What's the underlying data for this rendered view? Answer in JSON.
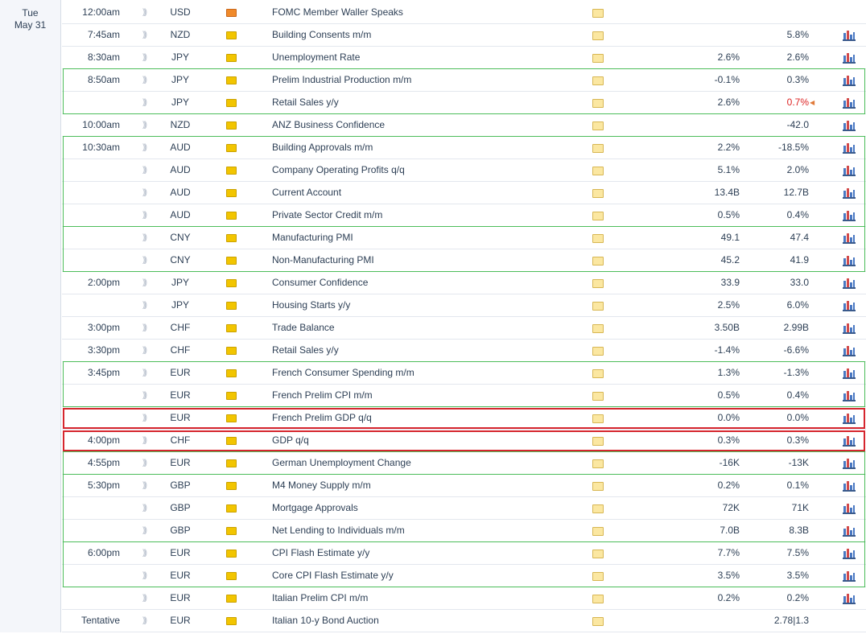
{
  "day": {
    "weekday": "Tue",
    "date": "May 31"
  },
  "colors": {
    "group_border": "#4cbd5a",
    "highlight_border": "#d6262e",
    "revised_value": "#dd2222"
  },
  "icons": {
    "sound": "sound-wave-icon",
    "volatility": "volatility-flag-icon",
    "detail": "folder-icon",
    "chart": "bar-chart-icon"
  },
  "rows": [
    {
      "time": "12:00am",
      "currency": "USD",
      "impact": "high",
      "event": "FOMC Member Waller Speaks",
      "forecast": "",
      "previous": "",
      "chart": false
    },
    {
      "time": "7:45am",
      "currency": "NZD",
      "impact": "medium",
      "event": "Building Consents m/m",
      "forecast": "",
      "previous": "5.8%",
      "chart": true
    },
    {
      "time": "8:30am",
      "currency": "JPY",
      "impact": "medium",
      "event": "Unemployment Rate",
      "forecast": "2.6%",
      "previous": "2.6%",
      "chart": true
    },
    {
      "time": "8:50am",
      "currency": "JPY",
      "impact": "medium",
      "event": "Prelim Industrial Production m/m",
      "forecast": "-0.1%",
      "previous": "0.3%",
      "chart": true
    },
    {
      "time": "",
      "currency": "JPY",
      "impact": "medium",
      "event": "Retail Sales y/y",
      "forecast": "2.6%",
      "previous": "0.7%",
      "revised": true,
      "chart": true
    },
    {
      "time": "10:00am",
      "currency": "NZD",
      "impact": "medium",
      "event": "ANZ Business Confidence",
      "forecast": "",
      "previous": "-42.0",
      "chart": true
    },
    {
      "time": "10:30am",
      "currency": "AUD",
      "impact": "medium",
      "event": "Building Approvals m/m",
      "forecast": "2.2%",
      "previous": "-18.5%",
      "chart": true
    },
    {
      "time": "",
      "currency": "AUD",
      "impact": "medium",
      "event": "Company Operating Profits q/q",
      "forecast": "5.1%",
      "previous": "2.0%",
      "chart": true
    },
    {
      "time": "",
      "currency": "AUD",
      "impact": "medium",
      "event": "Current Account",
      "forecast": "13.4B",
      "previous": "12.7B",
      "chart": true
    },
    {
      "time": "",
      "currency": "AUD",
      "impact": "medium",
      "event": "Private Sector Credit m/m",
      "forecast": "0.5%",
      "previous": "0.4%",
      "chart": true
    },
    {
      "time": "",
      "currency": "CNY",
      "impact": "medium",
      "event": "Manufacturing PMI",
      "forecast": "49.1",
      "previous": "47.4",
      "chart": true
    },
    {
      "time": "",
      "currency": "CNY",
      "impact": "medium",
      "event": "Non-Manufacturing PMI",
      "forecast": "45.2",
      "previous": "41.9",
      "chart": true
    },
    {
      "time": "2:00pm",
      "currency": "JPY",
      "impact": "medium",
      "event": "Consumer Confidence",
      "forecast": "33.9",
      "previous": "33.0",
      "chart": true
    },
    {
      "time": "",
      "currency": "JPY",
      "impact": "medium",
      "event": "Housing Starts y/y",
      "forecast": "2.5%",
      "previous": "6.0%",
      "chart": true
    },
    {
      "time": "3:00pm",
      "currency": "CHF",
      "impact": "medium",
      "event": "Trade Balance",
      "forecast": "3.50B",
      "previous": "2.99B",
      "chart": true
    },
    {
      "time": "3:30pm",
      "currency": "CHF",
      "impact": "medium",
      "event": "Retail Sales y/y",
      "forecast": "-1.4%",
      "previous": "-6.6%",
      "chart": true
    },
    {
      "time": "3:45pm",
      "currency": "EUR",
      "impact": "medium",
      "event": "French Consumer Spending m/m",
      "forecast": "1.3%",
      "previous": "-1.3%",
      "chart": true
    },
    {
      "time": "",
      "currency": "EUR",
      "impact": "medium",
      "event": "French Prelim CPI m/m",
      "forecast": "0.5%",
      "previous": "0.4%",
      "chart": true
    },
    {
      "time": "",
      "currency": "EUR",
      "impact": "medium",
      "event": "French Prelim GDP q/q",
      "forecast": "0.0%",
      "previous": "0.0%",
      "chart": true
    },
    {
      "time": "4:00pm",
      "currency": "CHF",
      "impact": "medium",
      "event": "GDP q/q",
      "forecast": "0.3%",
      "previous": "0.3%",
      "chart": true
    },
    {
      "time": "4:55pm",
      "currency": "EUR",
      "impact": "medium",
      "event": "German Unemployment Change",
      "forecast": "-16K",
      "previous": "-13K",
      "chart": true
    },
    {
      "time": "5:30pm",
      "currency": "GBP",
      "impact": "medium",
      "event": "M4 Money Supply m/m",
      "forecast": "0.2%",
      "previous": "0.1%",
      "chart": true
    },
    {
      "time": "",
      "currency": "GBP",
      "impact": "medium",
      "event": "Mortgage Approvals",
      "forecast": "72K",
      "previous": "71K",
      "chart": true
    },
    {
      "time": "",
      "currency": "GBP",
      "impact": "medium",
      "event": "Net Lending to Individuals m/m",
      "forecast": "7.0B",
      "previous": "8.3B",
      "chart": true
    },
    {
      "time": "6:00pm",
      "currency": "EUR",
      "impact": "medium",
      "event": "CPI Flash Estimate y/y",
      "forecast": "7.7%",
      "previous": "7.5%",
      "chart": true
    },
    {
      "time": "",
      "currency": "EUR",
      "impact": "medium",
      "event": "Core CPI Flash Estimate y/y",
      "forecast": "3.5%",
      "previous": "3.5%",
      "chart": true
    },
    {
      "time": "",
      "currency": "EUR",
      "impact": "medium",
      "event": "Italian Prelim CPI m/m",
      "forecast": "0.2%",
      "previous": "0.2%",
      "chart": true
    },
    {
      "time": "Tentative",
      "currency": "EUR",
      "impact": "medium",
      "event": "Italian 10-y Bond Auction",
      "forecast": "",
      "previous": "2.78|1.3",
      "chart": false
    }
  ],
  "groups": [
    {
      "start": 3,
      "count": 2
    },
    {
      "start": 6,
      "count": 4
    },
    {
      "start": 10,
      "count": 2
    },
    {
      "start": 16,
      "count": 2
    },
    {
      "start": 20,
      "count": 1
    },
    {
      "start": 21,
      "count": 3
    },
    {
      "start": 24,
      "count": 2
    }
  ],
  "highlights": [
    {
      "start": 18,
      "count": 1
    },
    {
      "start": 19,
      "count": 1
    }
  ]
}
